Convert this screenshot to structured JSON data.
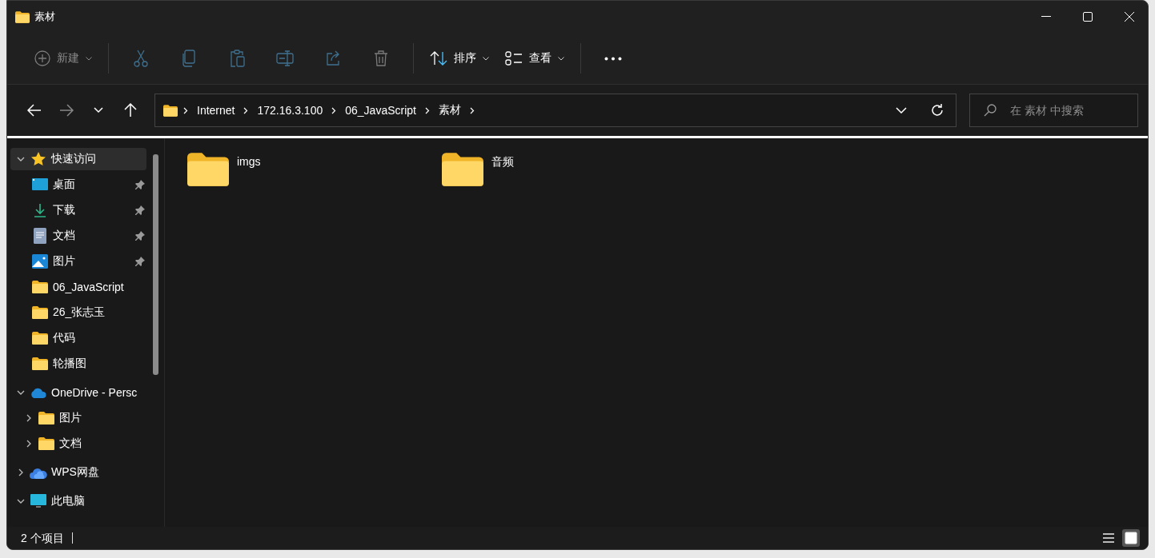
{
  "window": {
    "title": "素材"
  },
  "toolbar": [
    {
      "kind": "new",
      "label": "新建",
      "disabled": true
    },
    {
      "kind": "cut",
      "disabled": true
    },
    {
      "kind": "copy",
      "disabled": true
    },
    {
      "kind": "paste",
      "disabled": true
    },
    {
      "kind": "rename",
      "disabled": true
    },
    {
      "kind": "share",
      "disabled": true
    },
    {
      "kind": "delete",
      "disabled": true
    },
    {
      "kind": "sort",
      "label": "排序",
      "disabled": false
    },
    {
      "kind": "view",
      "label": "查看",
      "disabled": false
    },
    {
      "kind": "more",
      "disabled": false
    }
  ],
  "navigation": {
    "back_disabled": false,
    "forward_disabled": true
  },
  "address": {
    "segments": [
      "Internet",
      "172.16.3.100",
      "06_JavaScript",
      "素材"
    ]
  },
  "search": {
    "placeholder": "在 素材 中搜索"
  },
  "sidebar": {
    "items": [
      {
        "label": "快速访问",
        "kind": "star",
        "expanded": true,
        "selected": true,
        "children": [
          {
            "label": "桌面",
            "kind": "desktop",
            "pinned": true,
            "selected": false
          },
          {
            "label": "下载",
            "kind": "download",
            "pinned": true,
            "selected": false
          },
          {
            "label": "文档",
            "kind": "document",
            "pinned": true,
            "selected": false
          },
          {
            "label": "图片",
            "kind": "pictures",
            "pinned": true,
            "selected": false
          },
          {
            "label": "06_JavaScript",
            "kind": "folder",
            "pinned": false,
            "selected": false
          },
          {
            "label": "26_张志玉",
            "kind": "folder",
            "pinned": false,
            "selected": false
          },
          {
            "label": "代码",
            "kind": "folder",
            "pinned": false,
            "selected": false
          },
          {
            "label": "轮播图",
            "kind": "folder",
            "pinned": false,
            "selected": false
          }
        ]
      },
      {
        "label": "OneDrive - Persc",
        "kind": "cloud",
        "expanded": true,
        "selected": false,
        "children": [
          {
            "label": "图片",
            "kind": "folder",
            "expanded": false,
            "selected": false
          },
          {
            "label": "文档",
            "kind": "folder",
            "expanded": false,
            "selected": false
          }
        ]
      },
      {
        "label": "WPS网盘",
        "kind": "wps-cloud",
        "expanded": false,
        "selected": false
      },
      {
        "label": "此电脑",
        "kind": "pc",
        "expanded": true,
        "selected": false
      }
    ]
  },
  "files": [
    {
      "name": "imgs",
      "selected": false
    },
    {
      "name": "音频",
      "selected": false
    }
  ],
  "status_bar": {
    "text": "2 个项目",
    "views": [
      {
        "kind": "details",
        "selected": false
      },
      {
        "kind": "large-icons",
        "selected": true
      }
    ]
  }
}
